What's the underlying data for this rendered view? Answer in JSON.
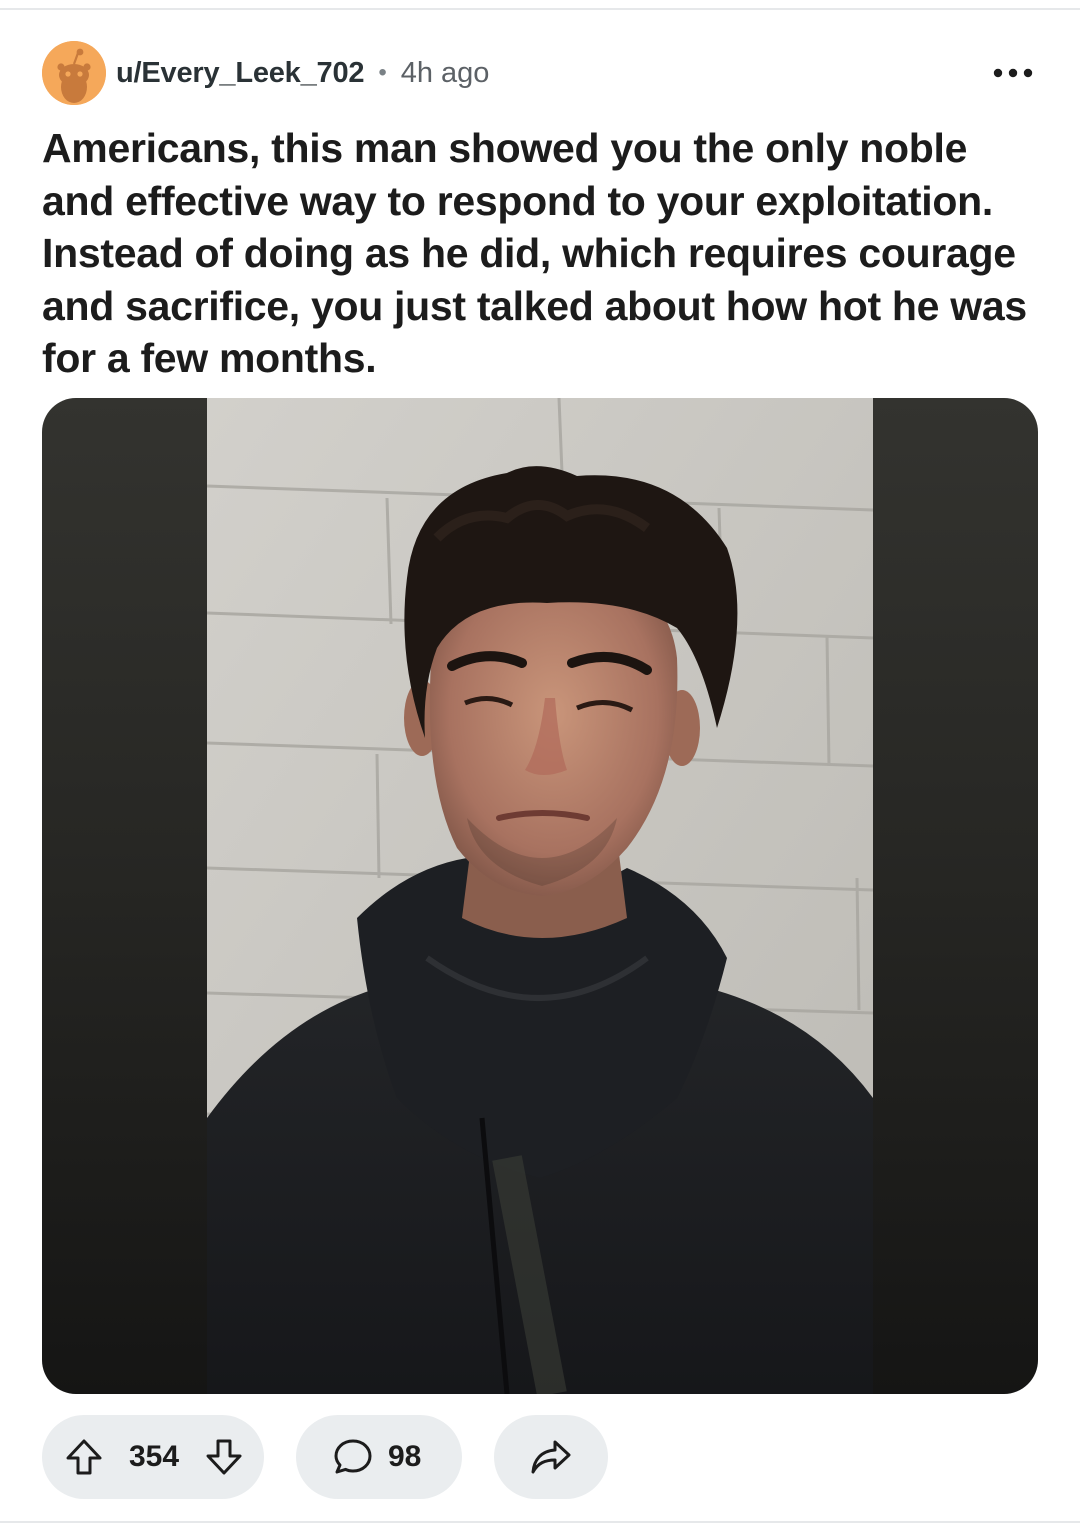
{
  "post": {
    "username": "u/Every_Leek_702",
    "separator": "•",
    "time_ago": "4h ago",
    "title": "Americans, this man showed you the only noble and effective way to respond to your exploitation. Instead of doing as he did, which requires courage and sacrifice, you just talked about how hot he was for a few months."
  },
  "actions": {
    "upvotes": "354",
    "comments": "98"
  },
  "icons": {
    "more": "more-horizontal-icon",
    "upvote": "arrow-up-icon",
    "downvote": "arrow-down-icon",
    "comment": "speech-bubble-icon",
    "share": "share-arrow-icon"
  },
  "colors": {
    "avatar": "#f5a85a",
    "pill_background": "#eaedef",
    "text": "#1c1c1c",
    "muted": "#5c6166"
  }
}
